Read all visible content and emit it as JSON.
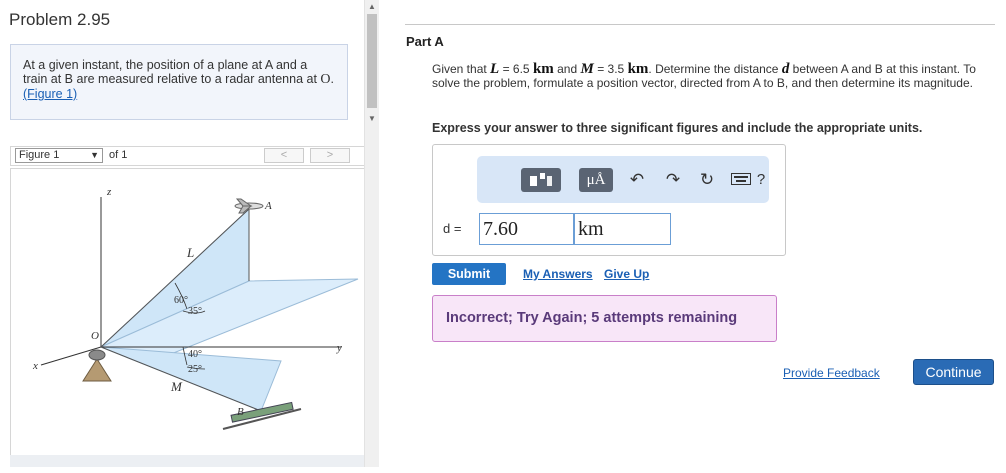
{
  "problem": {
    "title": "Problem 2.95",
    "text": "At a given instant, the position of a plane at A and a train at B are measured relative to a radar antenna at",
    "point": "O",
    "link_text": "(Figure 1)"
  },
  "figure_viewer": {
    "select_value": "Figure 1",
    "of_text": "of 1",
    "prev": "<",
    "next": ">",
    "diagram": {
      "z": "z",
      "y": "y",
      "x": "x",
      "O": "O",
      "A": "A",
      "B": "B",
      "L": "L",
      "M": "M",
      "angle1": "60°",
      "angle2": "35°",
      "angle3": "40°",
      "angle4": "25°"
    }
  },
  "part": {
    "label": "Part A",
    "question_pre": "Given that",
    "L_sym": "L",
    "L_val": "= 6.5",
    "L_unit": "km",
    "and": "and",
    "M_sym": "M",
    "M_val": "= 3.5",
    "M_unit": "km",
    "question_mid": ". Determine the distance",
    "d_sym": "d",
    "question_post": "between A and B at this instant. To solve the problem, formulate a position vector, directed from A to B, and then determine its magnitude.",
    "instruction": "Express your answer to three significant figures and include the appropriate units."
  },
  "toolbar": {
    "symbols_label": "μÅ",
    "help_label": "?"
  },
  "answer": {
    "label": "d =",
    "value": "7.60",
    "unit": "km"
  },
  "actions": {
    "submit": "Submit",
    "my_answers": "My Answers",
    "give_up": "Give Up",
    "feedback": "Incorrect; Try Again; 5 attempts remaining",
    "provide_feedback": "Provide Feedback",
    "continue": "Continue"
  },
  "colors": {
    "accent": "#2474c4",
    "feedback_bg": "#f8e6f8",
    "plane_fill": "#cfe6f8"
  }
}
